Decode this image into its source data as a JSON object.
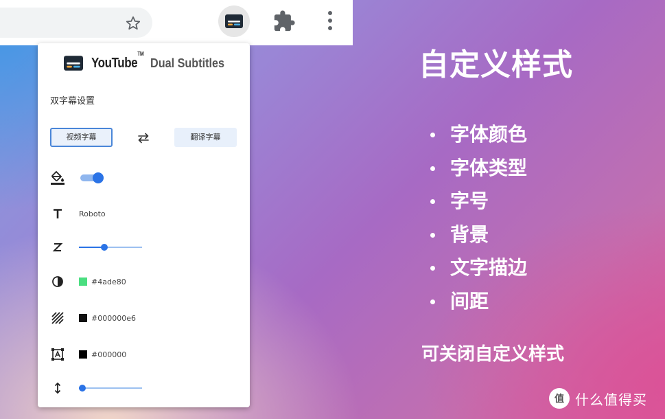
{
  "browser": {
    "icons": {
      "bookmark": "star-icon",
      "active_extension": "dual-subtitles-icon",
      "extensions": "puzzle-icon",
      "menu": "more-vert-icon"
    }
  },
  "popup": {
    "brand": {
      "youtube": "YouTube",
      "tm": "TM",
      "subtitle": "Dual Subtitles"
    },
    "section_title": "双字幕设置",
    "tabs": {
      "video": "视频字幕",
      "translated": "翻译字幕",
      "swap_icon": "swap-icon"
    },
    "settings": {
      "custom_style_icon": "format-color-fill-icon",
      "custom_style_enabled": true,
      "font_family_icon": "text-t-icon",
      "font_family": "Roboto",
      "font_size_icon": "font-size-z-icon",
      "font_size_level": 0.4,
      "text_color_icon": "contrast-icon",
      "text_color": "#4ade80",
      "background_icon": "hatch-icon",
      "background_color": "#000000e6",
      "outline_icon": "text-outline-icon",
      "outline_color": "#000000",
      "spacing_icon": "vertical-arrows-icon",
      "spacing_level": 0.05
    },
    "colors": {
      "accent": "#2b73e6",
      "text_swatch": "#4ade80",
      "background_swatch": "#111111",
      "outline_swatch": "#000000"
    }
  },
  "promo": {
    "headline": "自定义样式",
    "features": [
      "字体颜色",
      "字体类型",
      "字号",
      "背景",
      "文字描边",
      "间距"
    ],
    "closable": "可关闭自定义样式"
  },
  "watermark": {
    "text": "什么值得买",
    "icon": "smzdm-logo-icon",
    "badge": "值"
  }
}
